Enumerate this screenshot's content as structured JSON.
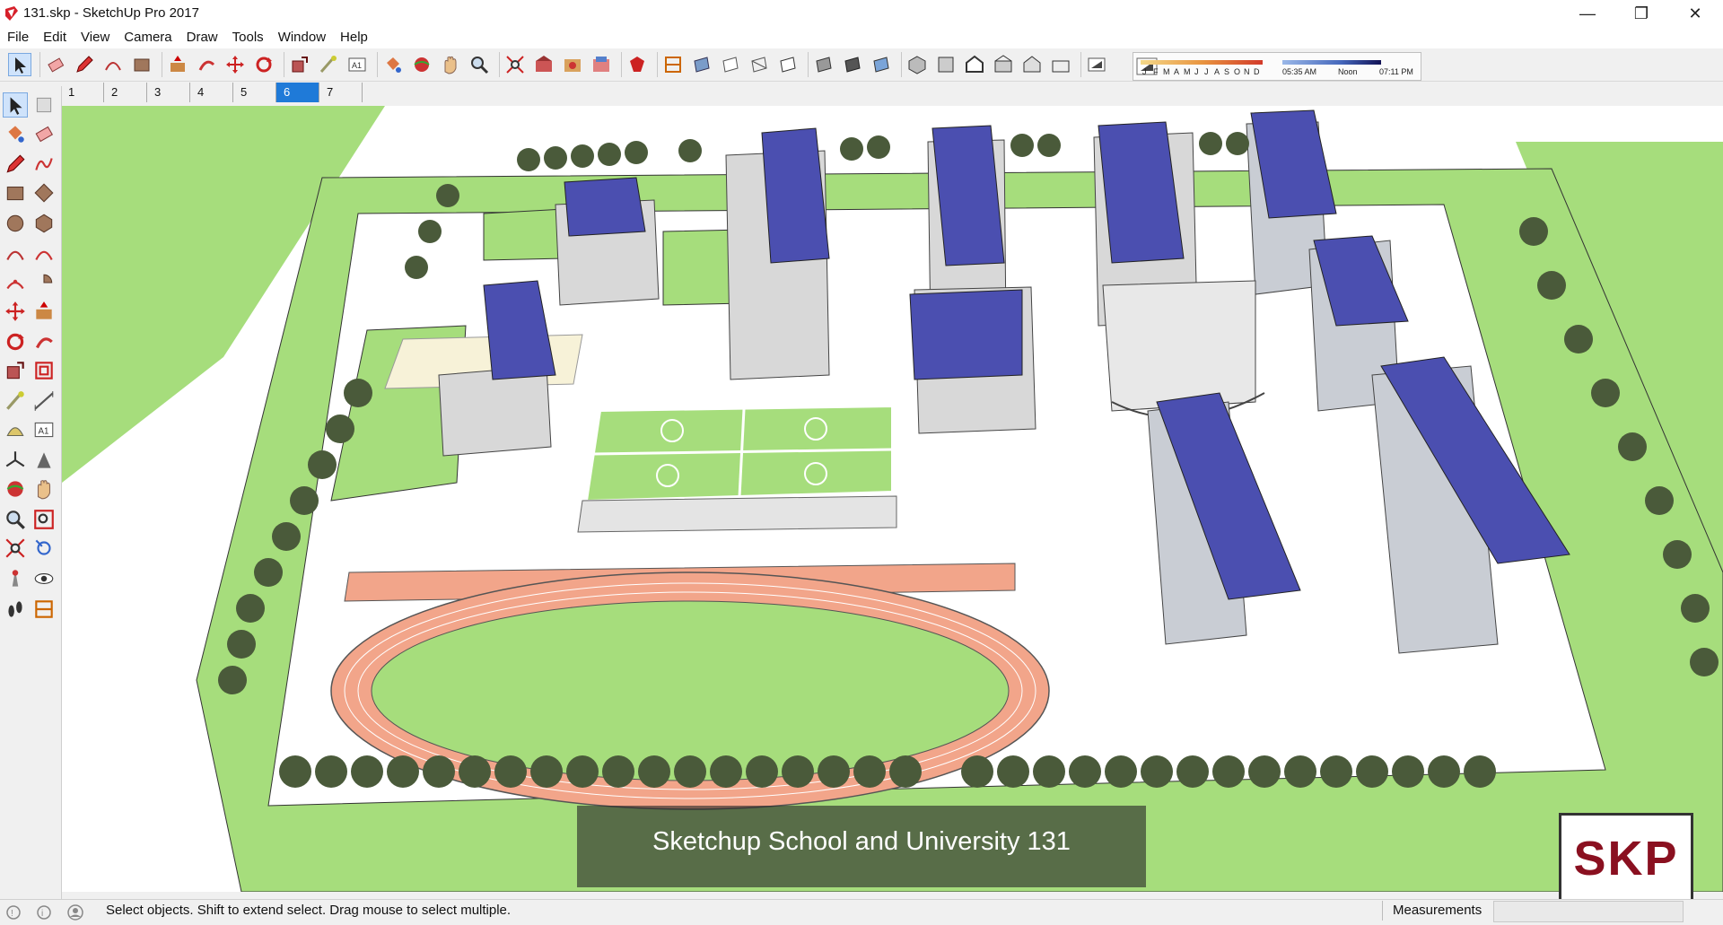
{
  "window": {
    "title": "131.skp - SketchUp Pro 2017",
    "minimize_icon": "minimize-icon",
    "maximize_icon": "restore-icon",
    "close_icon": "close-icon"
  },
  "menu": [
    "File",
    "Edit",
    "View",
    "Camera",
    "Draw",
    "Tools",
    "Window",
    "Help"
  ],
  "toolbar": {
    "icons": [
      "select-icon",
      "eraser-icon",
      "pencil-icon",
      "arc-icon",
      "rectangle-icon",
      "push-pull-icon",
      "follow-me-icon",
      "move-icon",
      "rotate-icon",
      "scale-icon",
      "tape-measure-icon",
      "text-icon",
      "paint-bucket-icon",
      "orbit-icon",
      "pan-icon",
      "zoom-icon",
      "zoom-extents-icon",
      "warehouse-icon",
      "components-icon",
      "share-icon",
      "extension-icon",
      "section-plane-icon",
      "section-fill-icon",
      "xray-icon",
      "wireframe-icon",
      "hidden-line-icon",
      "shaded-icon",
      "shaded-textures-icon",
      "monochrome-icon",
      "iso-view-icon",
      "top-view-icon",
      "front-view-icon",
      "right-view-icon",
      "back-view-icon",
      "left-view-icon",
      "shadows-toggle-icon"
    ]
  },
  "shadow_settings": {
    "months": [
      "J",
      "F",
      "M",
      "A",
      "M",
      "J",
      "J",
      "A",
      "S",
      "O",
      "N",
      "D"
    ],
    "time_start": "05:35 AM",
    "time_mid": "Noon",
    "time_end": "07:11 PM"
  },
  "scenes": {
    "tabs": [
      "1",
      "2",
      "3",
      "4",
      "5",
      "6",
      "7"
    ],
    "active_index": 5
  },
  "left_tools": [
    "select-icon",
    "make-component-icon",
    "paint-bucket-icon",
    "eraser-icon",
    "line-icon",
    "freehand-icon",
    "rectangle-icon",
    "rotated-rectangle-icon",
    "circle-icon",
    "polygon-icon",
    "arc-icon",
    "two-point-arc-icon",
    "three-point-arc-icon",
    "pie-icon",
    "move-icon",
    "push-pull-icon",
    "rotate-icon",
    "follow-me-icon",
    "scale-icon",
    "offset-icon",
    "tape-measure-icon",
    "dimension-icon",
    "protractor-icon",
    "text-icon",
    "axes-icon",
    "3d-text-icon",
    "orbit-icon",
    "pan-icon",
    "zoom-icon",
    "zoom-window-icon",
    "zoom-extents-icon",
    "previous-view-icon",
    "position-camera-icon",
    "look-around-icon",
    "walk-icon",
    "section-plane-icon"
  ],
  "overlay": {
    "caption": "Sketchup School and University 131",
    "logo_text": "SKP"
  },
  "statusbar": {
    "message": "Select objects. Shift to extend select. Drag mouse to select multiple.",
    "measurements_label": "Measurements",
    "measurements_value": ""
  },
  "colors": {
    "grass": "#a6dd7c",
    "roof": "#4b4fb0",
    "track": "#f2a58a",
    "tree": "#4a5a3a",
    "active_tab": "#1f7ad8",
    "logo": "#8a1020"
  }
}
